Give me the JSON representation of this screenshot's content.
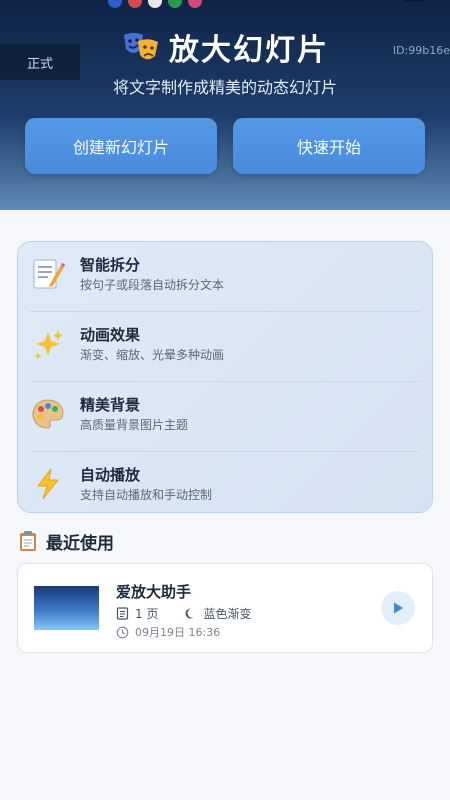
{
  "hero": {
    "env_badge": "正式",
    "id_label": "ID:99b16e",
    "title": "放大幻灯片",
    "subtitle": "将文字制作成精美的动态幻灯片",
    "create_button": "创建新幻灯片",
    "quick_start_button": "快速开始",
    "title_icon": "theater-masks-icon"
  },
  "features": [
    {
      "icon": "memo-icon",
      "title": "智能拆分",
      "desc": "按句子或段落自动拆分文本"
    },
    {
      "icon": "sparkles-icon",
      "title": "动画效果",
      "desc": "渐变、缩放、光晕多种动画"
    },
    {
      "icon": "palette-icon",
      "title": "精美背景",
      "desc": "高质量背景图片主题"
    },
    {
      "icon": "lightning-icon",
      "title": "自动播放",
      "desc": "支持自动播放和手动控制"
    }
  ],
  "recent": {
    "header_icon": "clipboard-icon",
    "title": "最近使用",
    "items": [
      {
        "title": "爱放大助手",
        "pages": "1 页",
        "theme": "蓝色渐变",
        "time": "09月19日 16:36"
      }
    ]
  },
  "colors": {
    "hero_dark": "#0f2446",
    "hero_light": "#5f8bb6",
    "button_blue": "#4a8bdc",
    "feature_bg": "#dfeaf7",
    "play_accent": "#3a86d8"
  }
}
